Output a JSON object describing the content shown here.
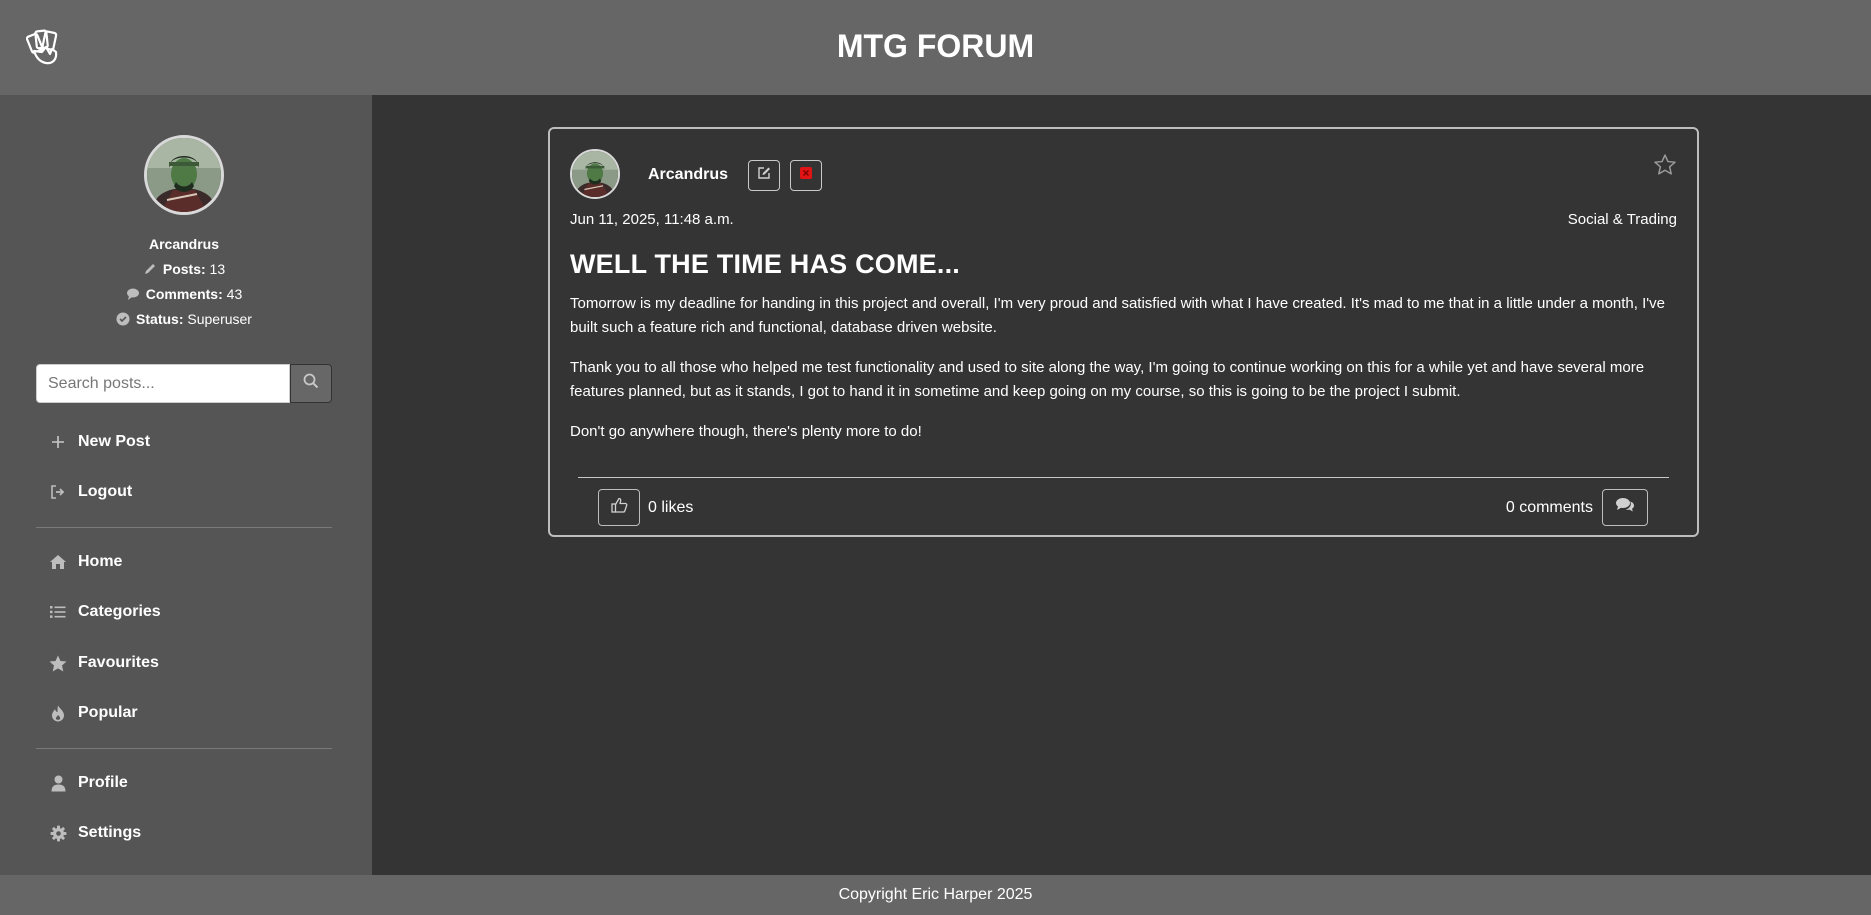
{
  "header": {
    "title": "MTG FORUM",
    "logo_icon": "playing-cards-icon"
  },
  "sidebar": {
    "profile": {
      "name": "Arcandrus",
      "posts_label": "Posts:",
      "posts_value": "13",
      "comments_label": "Comments:",
      "comments_value": "43",
      "status_label": "Status:",
      "status_value": "Superuser"
    },
    "search": {
      "placeholder": "Search posts...",
      "value": ""
    },
    "actions": [
      {
        "label": "New Post",
        "icon": "plus-icon"
      },
      {
        "label": "Logout",
        "icon": "logout-icon"
      }
    ],
    "nav": [
      {
        "label": "Home",
        "icon": "home-icon"
      },
      {
        "label": "Categories",
        "icon": "list-icon"
      },
      {
        "label": "Favourites",
        "icon": "star-icon"
      },
      {
        "label": "Popular",
        "icon": "fire-icon"
      }
    ],
    "account": [
      {
        "label": "Profile",
        "icon": "user-icon"
      },
      {
        "label": "Settings",
        "icon": "gear-icon"
      }
    ]
  },
  "post": {
    "author": "Arcandrus",
    "date": "Jun 11, 2025, 11:48 a.m.",
    "category": "Social & Trading",
    "title": "WELL THE TIME HAS COME...",
    "paragraphs": [
      "Tomorrow is my deadline for handing in this project and overall, I'm very proud and satisfied with what I have created. It's mad to me that in a little under a month, I've built such a feature rich and functional, database driven website.",
      "Thank you to all those who helped me test functionality and used to site along the way, I'm going to continue working on this for a while yet and have several more features planned, but as it stands, I got to hand it in sometime and keep going on my course, so this is going to be the project I submit.",
      "Don't go anywhere though, there's plenty more to do!"
    ],
    "likes": "0 likes",
    "comments": "0 comments"
  },
  "footer": {
    "text": "Copyright Eric Harper 2025"
  },
  "colors": {
    "header_bg": "#666666",
    "sidebar_bg": "#555555",
    "main_bg": "#343434",
    "delete_red": "#e01414"
  }
}
